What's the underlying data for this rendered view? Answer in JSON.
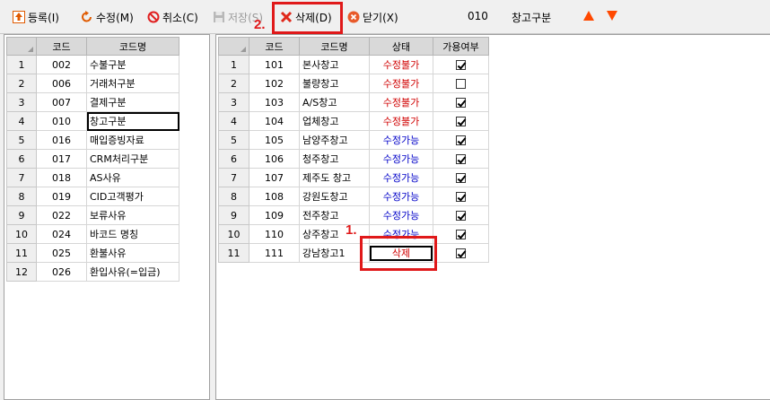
{
  "toolbar": {
    "register": "등록(I)",
    "edit": "수정(M)",
    "cancel": "취소(C)",
    "save": "저장(S)",
    "delete": "삭제(D)",
    "close": "닫기(X)",
    "code_value": "010",
    "code_name": "창고구분"
  },
  "left_grid": {
    "headers": [
      "코드",
      "코드명"
    ],
    "rows": [
      {
        "n": "1",
        "code": "002",
        "name": "수불구분"
      },
      {
        "n": "2",
        "code": "006",
        "name": "거래처구분"
      },
      {
        "n": "3",
        "code": "007",
        "name": "결제구분"
      },
      {
        "n": "4",
        "code": "010",
        "name": "창고구분"
      },
      {
        "n": "5",
        "code": "016",
        "name": "매입증빙자료"
      },
      {
        "n": "6",
        "code": "017",
        "name": "CRM처리구분"
      },
      {
        "n": "7",
        "code": "018",
        "name": "AS사유"
      },
      {
        "n": "8",
        "code": "019",
        "name": "CID고객평가"
      },
      {
        "n": "9",
        "code": "022",
        "name": "보류사유"
      },
      {
        "n": "10",
        "code": "024",
        "name": "바코드 명칭"
      },
      {
        "n": "11",
        "code": "025",
        "name": "환불사유"
      },
      {
        "n": "12",
        "code": "026",
        "name": "환입사유(=입금)"
      }
    ]
  },
  "right_grid": {
    "headers": [
      "코드",
      "코드명",
      "상태",
      "가용여부"
    ],
    "rows": [
      {
        "n": "1",
        "code": "101",
        "name": "본사창고",
        "status": "수정불가",
        "avail": true
      },
      {
        "n": "2",
        "code": "102",
        "name": "불량창고",
        "status": "수정불가",
        "avail": false
      },
      {
        "n": "3",
        "code": "103",
        "name": "A/S창고",
        "status": "수정불가",
        "avail": true
      },
      {
        "n": "4",
        "code": "104",
        "name": "업체창고",
        "status": "수정불가",
        "avail": true
      },
      {
        "n": "5",
        "code": "105",
        "name": "남양주창고",
        "status": "수정가능",
        "avail": true
      },
      {
        "n": "6",
        "code": "106",
        "name": "청주창고",
        "status": "수정가능",
        "avail": true
      },
      {
        "n": "7",
        "code": "107",
        "name": "제주도 창고",
        "status": "수정가능",
        "avail": true
      },
      {
        "n": "8",
        "code": "108",
        "name": "강원도창고",
        "status": "수정가능",
        "avail": true
      },
      {
        "n": "9",
        "code": "109",
        "name": "전주창고",
        "status": "수정가능",
        "avail": true
      },
      {
        "n": "10",
        "code": "110",
        "name": "상주창고",
        "status": "수정가능",
        "avail": true
      },
      {
        "n": "11",
        "code": "111",
        "name": "강남창고1",
        "status": "삭제",
        "avail": true
      }
    ]
  },
  "annotations": {
    "step1": "1.",
    "step2": "2."
  },
  "colors": {
    "annotation": "#e0191a",
    "status_locked": "#d00000",
    "status_editable": "#0000c8",
    "arrow": "#ff4800"
  },
  "icons": [
    "register-icon",
    "edit-icon",
    "cancel-icon",
    "save-icon",
    "delete-icon",
    "close-icon",
    "up-arrow-icon",
    "down-arrow-icon"
  ]
}
